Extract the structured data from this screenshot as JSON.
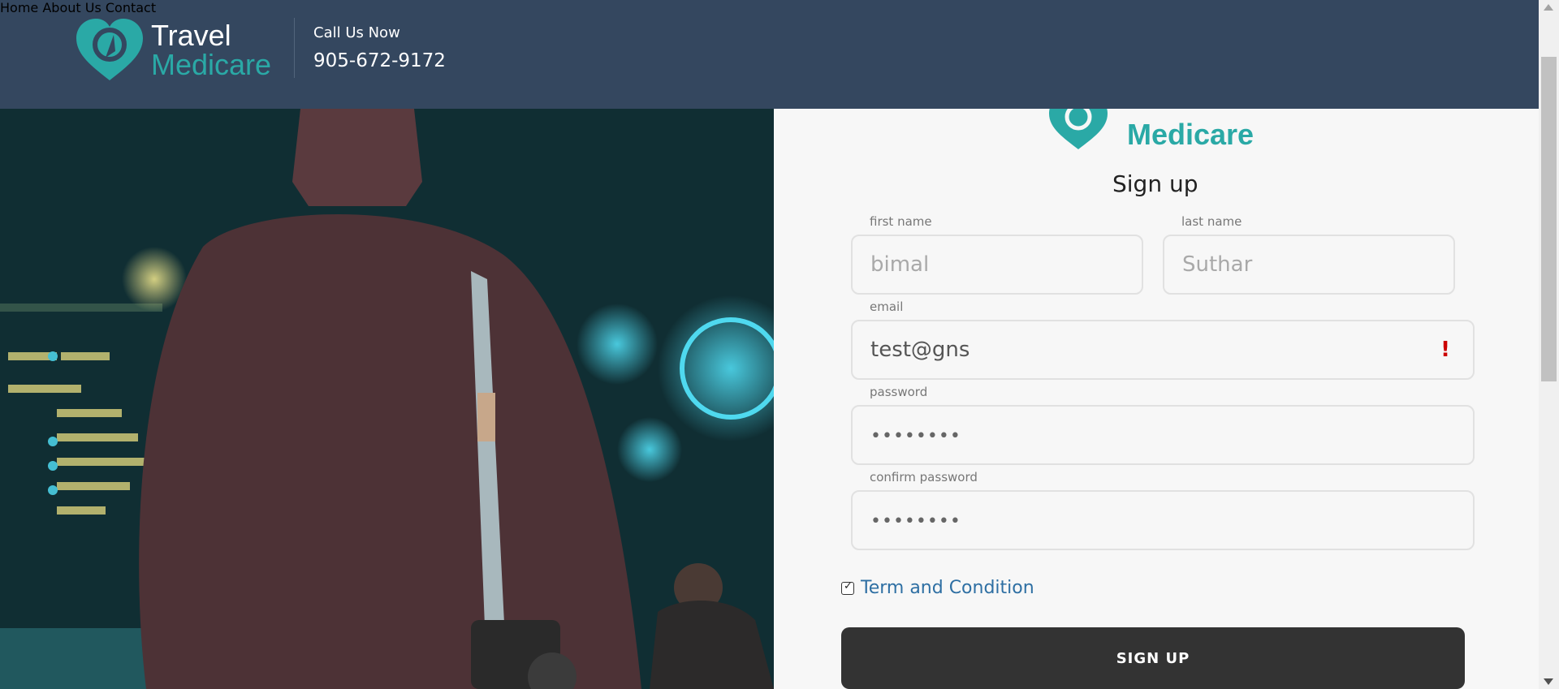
{
  "brand": {
    "line1": "Travel",
    "line2": "Medicare",
    "colors": {
      "header_bg": "#34475f",
      "teal": "#2aa9a6"
    }
  },
  "header": {
    "call_label": "Call Us Now",
    "phone": "905-672-9172",
    "nav": [
      {
        "label": "Home"
      },
      {
        "label": "About Us"
      },
      {
        "label": "Contact"
      }
    ]
  },
  "form": {
    "title": "Sign up",
    "first_name": {
      "label": "first name",
      "value": "bimal"
    },
    "last_name": {
      "label": "last name",
      "value": "Suthar"
    },
    "email": {
      "label": "email",
      "value": "test@gns",
      "alert_icon": "!"
    },
    "password": {
      "label": "password",
      "value": "••••••••"
    },
    "confirm_password": {
      "label": "confirm password",
      "value": "••••••••"
    },
    "terms": {
      "checked": true,
      "label": "Term and Condition"
    },
    "submit_label": "SIGN UP"
  }
}
